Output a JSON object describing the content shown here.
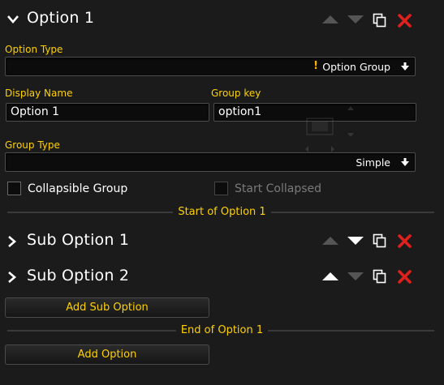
{
  "option": {
    "title": "Option 1",
    "option_type_label": "Option Type",
    "option_type_value": "Option Group",
    "display_name_label": "Display Name",
    "display_name_value": "Option 1",
    "group_key_label": "Group key",
    "group_key_value": "option1",
    "group_type_label": "Group Type",
    "group_type_value": "Simple",
    "collapsible_label": "Collapsible Group",
    "start_collapsed_label": "Start Collapsed",
    "start_divider": "Start of Option 1",
    "end_divider": "End of Option 1"
  },
  "sub_options": [
    {
      "title": "Sub Option 1"
    },
    {
      "title": "Sub Option 2"
    }
  ],
  "buttons": {
    "add_sub_option": "Add Sub Option",
    "add_option": "Add Option"
  },
  "colors": {
    "accent": "#ffd100",
    "delete": "#e0201c",
    "background": "#1b1b1b",
    "arrow_enabled": "#ffffff",
    "arrow_disabled": "#555555"
  },
  "icons": {
    "expand": "chevron-down-icon",
    "collapse": "chevron-right-icon",
    "move_up": "arrow-up-icon",
    "move_down": "arrow-down-icon",
    "duplicate": "duplicate-icon",
    "delete": "delete-x-icon",
    "warning": "exclamation-icon",
    "dropdown": "dropdown-arrow-icon"
  }
}
